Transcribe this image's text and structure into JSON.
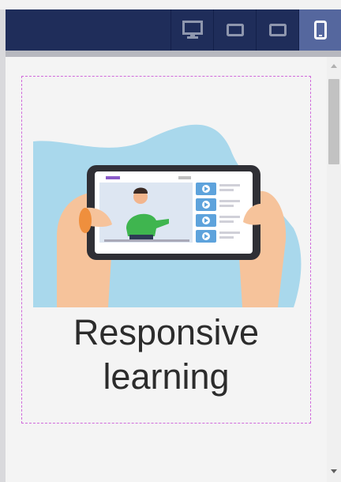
{
  "toolbar": {
    "buttons": [
      {
        "name": "desktop-view",
        "icon": "monitor-icon",
        "active": false
      },
      {
        "name": "tablet-landscape-view",
        "icon": "tablet-landscape-icon",
        "active": false
      },
      {
        "name": "phone-landscape-view",
        "icon": "phone-landscape-icon",
        "active": false
      },
      {
        "name": "phone-portrait-view",
        "icon": "phone-portrait-icon",
        "active": true
      }
    ]
  },
  "content": {
    "caption_line1": "Responsive",
    "caption_line2": "learning",
    "illustration": "hands-holding-phone-video-lesson"
  },
  "colors": {
    "toolbar_bg": "#1f2d5a",
    "active_button": "#55679e",
    "selection_border": "#d06adb",
    "blob": "#a9d8ec"
  }
}
